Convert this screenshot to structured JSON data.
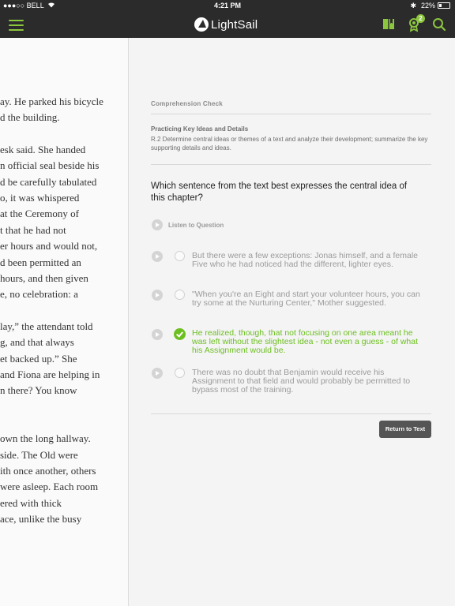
{
  "status_bar": {
    "carrier": "●●●○○ BELL",
    "time": "4:21 PM",
    "battery": "22%",
    "battery_level": 0.22
  },
  "navbar": {
    "brand": "LightSail",
    "badge_count": "2",
    "accent_color": "#8cc63f"
  },
  "reader": {
    "lines": [
      "ay. He parked his bicycle",
      "d the building.",
      "",
      "esk said. She handed",
      "n official seal beside his",
      "d be carefully tabulated",
      "o, it was whispered",
      "at the Ceremony of",
      "t that he had not",
      "er hours and would not,",
      "d been permitted an",
      " hours, and then given",
      "e, no celebration: a",
      "",
      "lay,” the attendant told",
      "g, and that always",
      "et backed up.” She",
      " and Fiona are helping in",
      "n there? You know",
      "",
      "",
      "own the long hallway.",
      "side. The Old were",
      "ith once another, others",
      "were asleep. Each room",
      "ered with thick",
      "ace, unlike the busy"
    ]
  },
  "panel": {
    "section_title": "Comprehension Check",
    "standard_title": "Practicing Key Ideas and Details",
    "standard_text": "R.2 Determine central ideas or themes of a text and analyze their development; summarize the key supporting details and ideas.",
    "question": "Which sentence from the text best expresses the central idea of this chapter?",
    "listen_label": "Listen to Question",
    "answers": [
      {
        "text": "But there were a few exceptions: Jonas himself, and a female Five who he had noticed had the different, lighter eyes.",
        "selected": false
      },
      {
        "text": "\"When you're an Eight and start your volunteer hours, you can try some at the Nurturing Center,\" Mother suggested.",
        "selected": false
      },
      {
        "text": "He realized, though, that not focusing on one area meant he was left without the slightest idea - not even a guess - of what his Assignment would be.",
        "selected": true
      },
      {
        "text": "There was no doubt that Benjamin would receive his Assignment to that field and would probably be permitted to bypass most of the training.",
        "selected": false
      }
    ],
    "return_button": "Return to Text",
    "correct_color": "#6cbf20"
  }
}
